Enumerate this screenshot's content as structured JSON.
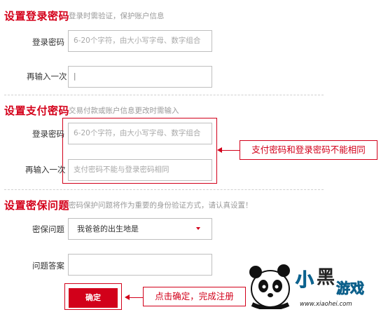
{
  "section_login": {
    "title": "设置登录密码",
    "subtitle": "登录时需验证，保护账户信息",
    "password_label": "登录密码",
    "password_placeholder": "6-20个字符，由大小写字母、数字组合",
    "confirm_label": "再输入一次",
    "confirm_value": "|"
  },
  "section_pay": {
    "title": "设置支付密码",
    "subtitle": "交易付款或账户信息更改时需输入",
    "password_label": "登录密码",
    "password_placeholder": "6-20个字符，由大小写字母、数字组合",
    "confirm_label": "再输入一次",
    "confirm_placeholder": "支付密码不能与登录密码相同",
    "callout": "支付密码和登录密码不能相同"
  },
  "section_security": {
    "title": "设置密保问题",
    "subtitle": "密码保护问题将作为重要的身份验证方式，请认真设置！",
    "question_label": "密保问题",
    "question_value": "我爸爸的出生地是",
    "answer_label": "问题答案",
    "answer_value": ""
  },
  "submit": {
    "label": "确定",
    "callout": "点击确定，完成注册"
  },
  "watermark": {
    "logo_text": "小黑游戏",
    "url": "www.xiaohei.com"
  },
  "colors": {
    "accent": "#d2001a",
    "border": "#bfbfbf",
    "placeholder": "#a8a8a8"
  }
}
